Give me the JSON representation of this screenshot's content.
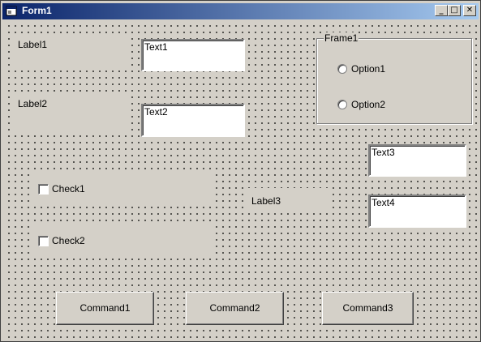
{
  "window": {
    "title": "Form1"
  },
  "titlebar_buttons": {
    "minimize": "_",
    "maximize": "□",
    "close": "✕"
  },
  "labels": {
    "label1": "Label1",
    "label2": "Label2",
    "label3": "Label3"
  },
  "textboxes": {
    "text1": "Text1",
    "text2": "Text2",
    "text3": "Text3",
    "text4": "Text4"
  },
  "frame": {
    "caption": "Frame1",
    "option1": "Option1",
    "option2": "Option2"
  },
  "checkboxes": {
    "check1": "Check1",
    "check2": "Check2"
  },
  "buttons": {
    "command1": "Command1",
    "command2": "Command2",
    "command3": "Command3"
  },
  "colors": {
    "title_start": "#0a246a",
    "title_end": "#a6caf0",
    "face": "#d4d0c8"
  }
}
